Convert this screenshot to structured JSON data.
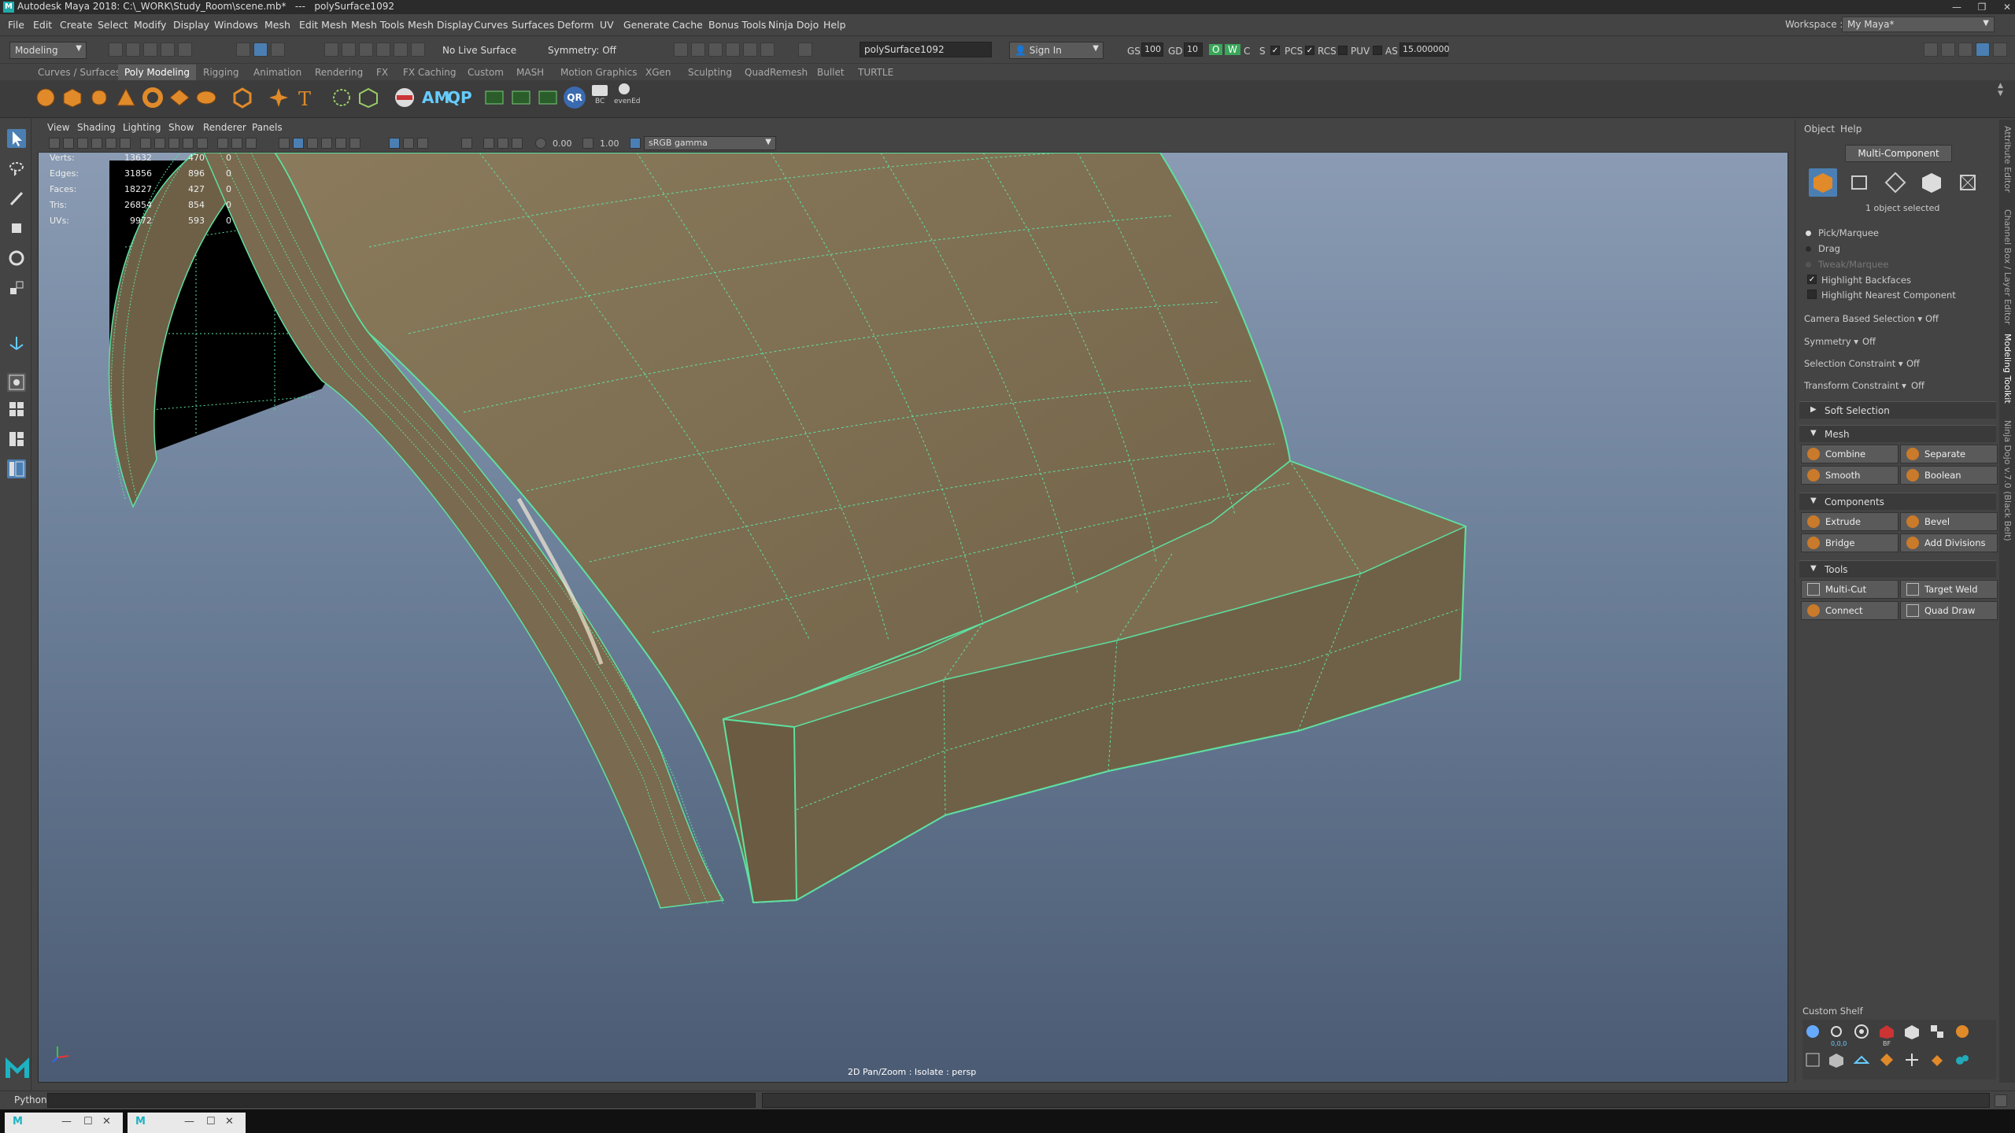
{
  "window": {
    "title": "Autodesk Maya 2018: C:\\_WORK\\Study_Room\\scene.mb*   ---   polySurface1092",
    "controls": [
      "—",
      "❐",
      "✕"
    ]
  },
  "menus": [
    "File",
    "Edit",
    "Create",
    "Select",
    "Modify",
    "Display",
    "Windows",
    "Mesh",
    "Edit Mesh",
    "Mesh Tools",
    "Mesh Display",
    "Curves",
    "Surfaces",
    "Deform",
    "UV",
    "Generate",
    "Cache",
    "Bonus Tools",
    "Ninja Dojo",
    "Help"
  ],
  "workspace": {
    "label": "Workspace :",
    "value": "My Maya*"
  },
  "statusline": {
    "menu_set": "Modeling",
    "live_surface": "No Live Surface",
    "symmetry": "Symmetry: Off",
    "object_field": "polySurface1092",
    "sign_in": "Sign In",
    "gs_label": "GS",
    "gs_value": "100",
    "gd_label": "GD",
    "gd_value": "10",
    "o_label": "O",
    "w_label": "W",
    "c_label": "C",
    "s_label": "S",
    "pcs": "PCS",
    "rcs": "RCS",
    "puv": "PUV",
    "as_label": "AS",
    "as_value": "15.000000"
  },
  "shelf_tabs": [
    "Curves / Surfaces",
    "Poly Modeling",
    "Rigging",
    "Animation",
    "Rendering",
    "FX",
    "FX Caching",
    "Custom",
    "MASH",
    "Motion Graphics",
    "XGen",
    "Sculpting",
    "QuadRemesh",
    "Bullet",
    "TURTLE"
  ],
  "shelf_active": "Poly Modeling",
  "shelf_labels": {
    "am": "AM",
    "qp": "QP",
    "qr": "QR",
    "bc": "BC",
    "evened": "evenEd"
  },
  "viewport": {
    "menus": [
      "View",
      "Shading",
      "Lighting",
      "Show",
      "Renderer",
      "Panels"
    ],
    "exposure": "0.00",
    "gamma": "1.00",
    "color_space": "sRGB gamma",
    "hud": [
      {
        "label": "Verts:",
        "v1": "13632",
        "v2": "470",
        "v3": "0"
      },
      {
        "label": "Edges:",
        "v1": "31856",
        "v2": "896",
        "v3": "0"
      },
      {
        "label": "Faces:",
        "v1": "18227",
        "v2": "427",
        "v3": "0"
      },
      {
        "label": "Tris:",
        "v1": "26854",
        "v2": "854",
        "v3": "0"
      },
      {
        "label": "UVs:",
        "v1": "9972",
        "v2": "593",
        "v3": "0"
      }
    ],
    "caption": "2D Pan/Zoom : Isolate : persp"
  },
  "modeling_toolkit": {
    "tabs": [
      "Object",
      "Help"
    ],
    "mode_button": "Multi-Component",
    "selection_info": "1 object selected",
    "pick_marquee": "Pick/Marquee",
    "drag": "Drag",
    "tweak_marquee": "Tweak/Marquee",
    "highlight_backfaces": "Highlight Backfaces",
    "highlight_nearest": "Highlight Nearest Component",
    "camera_based": {
      "label": "Camera Based Selection",
      "value": "Off"
    },
    "symmetry": {
      "label": "Symmetry",
      "value": "Off"
    },
    "selection_constraint": {
      "label": "Selection Constraint",
      "value": "Off"
    },
    "transform_constraint": {
      "label": "Transform Constraint",
      "value": "Off"
    },
    "soft_selection": "Soft Selection",
    "mesh": {
      "title": "Mesh",
      "combine": "Combine",
      "separate": "Separate",
      "smooth": "Smooth",
      "boolean": "Boolean"
    },
    "components": {
      "title": "Components",
      "extrude": "Extrude",
      "bevel": "Bevel",
      "bridge": "Bridge",
      "add_divisions": "Add Divisions"
    },
    "tools": {
      "title": "Tools",
      "multi_cut": "Multi-Cut",
      "target_weld": "Target Weld",
      "connect": "Connect",
      "quad_draw": "Quad Draw"
    },
    "custom_shelf": "Custom Shelf",
    "custom_labels": {
      "zero": "0,0,0",
      "bf": "BF"
    }
  },
  "side_tabs": [
    "Attribute Editor",
    "Channel Box / Layer Editor",
    "Modeling Toolkit",
    "Ninja Dojo v.7.0 (Black Belt)"
  ],
  "command_line": {
    "language": "Python"
  },
  "accent": "#5ee0a0"
}
